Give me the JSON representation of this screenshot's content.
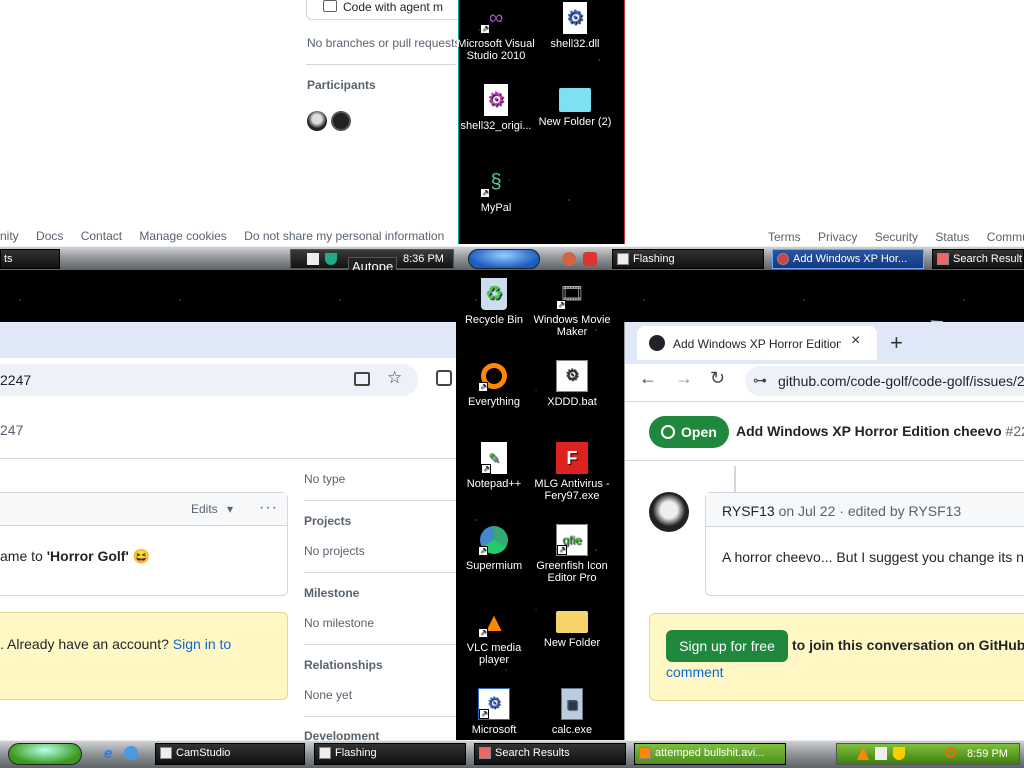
{
  "top_browser": {
    "code_with_agent": "Code with agent m",
    "no_branches": "No branches or pull requests",
    "participants_heading": "Participants",
    "footer_links": [
      "nity",
      "Docs",
      "Contact",
      "Manage cookies",
      "Do not share my personal information"
    ],
    "footer_links_right": [
      "Terms",
      "Privacy",
      "Security",
      "Status",
      "Commu"
    ]
  },
  "top_desktop_icons": [
    {
      "label": "Microsoft Visual Studio 2010",
      "icon": "visual-studio-icon"
    },
    {
      "label": "shell32.dll",
      "icon": "dll-icon"
    },
    {
      "label": "shell32_origi...",
      "icon": "dll-icon"
    },
    {
      "label": "New Folder (2)",
      "icon": "folder-icon"
    },
    {
      "label": "MyPal",
      "icon": "mypal-icon"
    }
  ],
  "top_taskbar_left": {
    "label": "ts"
  },
  "top_taskbar_left_tray": {
    "clock": "8:36 PM",
    "tooltip": "Autope"
  },
  "top_taskbar_right": {
    "buttons": [
      {
        "label": "Flashing"
      },
      {
        "label": "Add Windows XP Hor..."
      },
      {
        "label": "Search Result"
      }
    ]
  },
  "left_browser": {
    "url_fragment": "2247",
    "issue_fragment": "247",
    "edits_label": "Edits",
    "comment_text_prefix": "ame to ",
    "comment_bold": "'Horror Golf'",
    "comment_emoji": "😆",
    "signin_text": ". Already have an account? ",
    "signin_link": "Sign in to",
    "sidebar": [
      {
        "heading": "",
        "value": "No type"
      },
      {
        "heading": "Projects",
        "value": "No projects"
      },
      {
        "heading": "Milestone",
        "value": "No milestone"
      },
      {
        "heading": "Relationships",
        "value": "None yet"
      },
      {
        "heading": "Development",
        "value": ""
      }
    ]
  },
  "mid_desktop_icons": [
    {
      "label": "Recycle Bin",
      "icon": "recycle-bin-icon"
    },
    {
      "label": "Windows Movie Maker",
      "icon": "movie-maker-icon"
    },
    {
      "label": "Everything",
      "icon": "everything-icon"
    },
    {
      "label": "XDDD.bat",
      "icon": "batch-file-icon"
    },
    {
      "label": "Notepad++",
      "icon": "notepad-plus-icon"
    },
    {
      "label": "MLG Antivirus - Fery97.exe",
      "icon": "antivirus-icon"
    },
    {
      "label": "Supermium",
      "icon": "supermium-icon"
    },
    {
      "label": "Greenfish Icon Editor Pro",
      "icon": "greenfish-icon"
    },
    {
      "label": "VLC media player",
      "icon": "vlc-icon"
    },
    {
      "label": "New Folder",
      "icon": "folder-icon"
    },
    {
      "label": "Microsoft",
      "icon": "program-icon"
    },
    {
      "label": "calc.exe",
      "icon": "calculator-icon"
    }
  ],
  "right_browser": {
    "tab_title": "Add Windows XP Horror Edition ch",
    "url": "github.com/code-golf/code-golf/issues/2",
    "status_badge": "Open",
    "issue_title": "Add Windows XP Horror Edition cheevo",
    "issue_number": "#22",
    "comment_author": "RYSF13",
    "comment_meta": "on Jul 22 · edited by RYSF13",
    "comment_body": "A horror cheevo... But I suggest you change its n",
    "signup_button": "Sign up for free",
    "signup_text": "to join this conversation on GitHub",
    "signup_comment": "comment"
  },
  "bottom_taskbar": {
    "buttons": [
      {
        "label": "CamStudio"
      },
      {
        "label": "Flashing"
      },
      {
        "label": "Search Results"
      },
      {
        "label": "attemped bullshit.avi..."
      }
    ],
    "clock": "8:59 PM"
  },
  "colors": {
    "gh_green": "#1f883d",
    "gh_blue": "#0969da",
    "xp_green": "#4caf2a"
  }
}
